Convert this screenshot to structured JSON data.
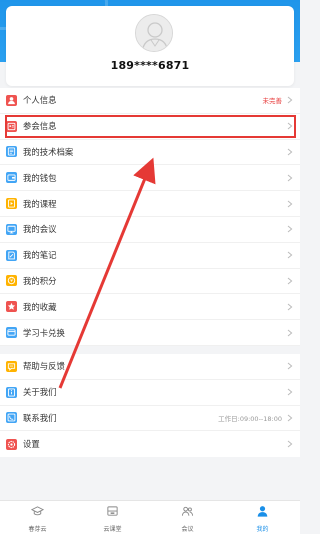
{
  "profile": {
    "phone": "189****6871"
  },
  "menu_groups": [
    [
      {
        "key": "personal",
        "label": "个人信息",
        "icon": "person-icon",
        "color": "#ef5350",
        "extra": "未完善",
        "extra_red": true
      },
      {
        "key": "meeting-info",
        "label": "参会信息",
        "icon": "badge-icon",
        "color": "#ef5350"
      },
      {
        "key": "tech-archive",
        "label": "我的技术档案",
        "icon": "archive-icon",
        "color": "#42a5f5"
      },
      {
        "key": "wallet",
        "label": "我的钱包",
        "icon": "wallet-icon",
        "color": "#42a5f5"
      },
      {
        "key": "courses",
        "label": "我的课程",
        "icon": "course-icon",
        "color": "#ffb300"
      },
      {
        "key": "meetings",
        "label": "我的会议",
        "icon": "meeting-icon",
        "color": "#42a5f5"
      },
      {
        "key": "notes",
        "label": "我的笔记",
        "icon": "note-icon",
        "color": "#42a5f5"
      },
      {
        "key": "points",
        "label": "我的积分",
        "icon": "points-icon",
        "color": "#ffb300"
      },
      {
        "key": "favorites",
        "label": "我的收藏",
        "icon": "star-icon",
        "color": "#ef5350"
      },
      {
        "key": "study-card",
        "label": "学习卡兑换",
        "icon": "card-icon",
        "color": "#42a5f5"
      }
    ],
    [
      {
        "key": "help",
        "label": "帮助与反馈",
        "icon": "help-icon",
        "color": "#ffb300"
      },
      {
        "key": "about",
        "label": "关于我们",
        "icon": "about-icon",
        "color": "#42a5f5"
      },
      {
        "key": "contact",
        "label": "联系我们",
        "icon": "contact-icon",
        "color": "#42a5f5",
        "extra": "工作日:09:00--18:00"
      },
      {
        "key": "settings",
        "label": "设置",
        "icon": "gear-icon",
        "color": "#ef5350"
      }
    ]
  ],
  "tabs": [
    {
      "key": "home",
      "label": "春芽云",
      "icon": "graduation-cap-icon",
      "active": false
    },
    {
      "key": "cloud-class",
      "label": "云课堂",
      "icon": "classroom-icon",
      "active": false
    },
    {
      "key": "meeting",
      "label": "会议",
      "icon": "people-icon",
      "active": false
    },
    {
      "key": "mine",
      "label": "我的",
      "icon": "user-icon",
      "active": true
    }
  ],
  "colors": {
    "accent": "#1a8fe8",
    "highlight": "#e53935"
  }
}
